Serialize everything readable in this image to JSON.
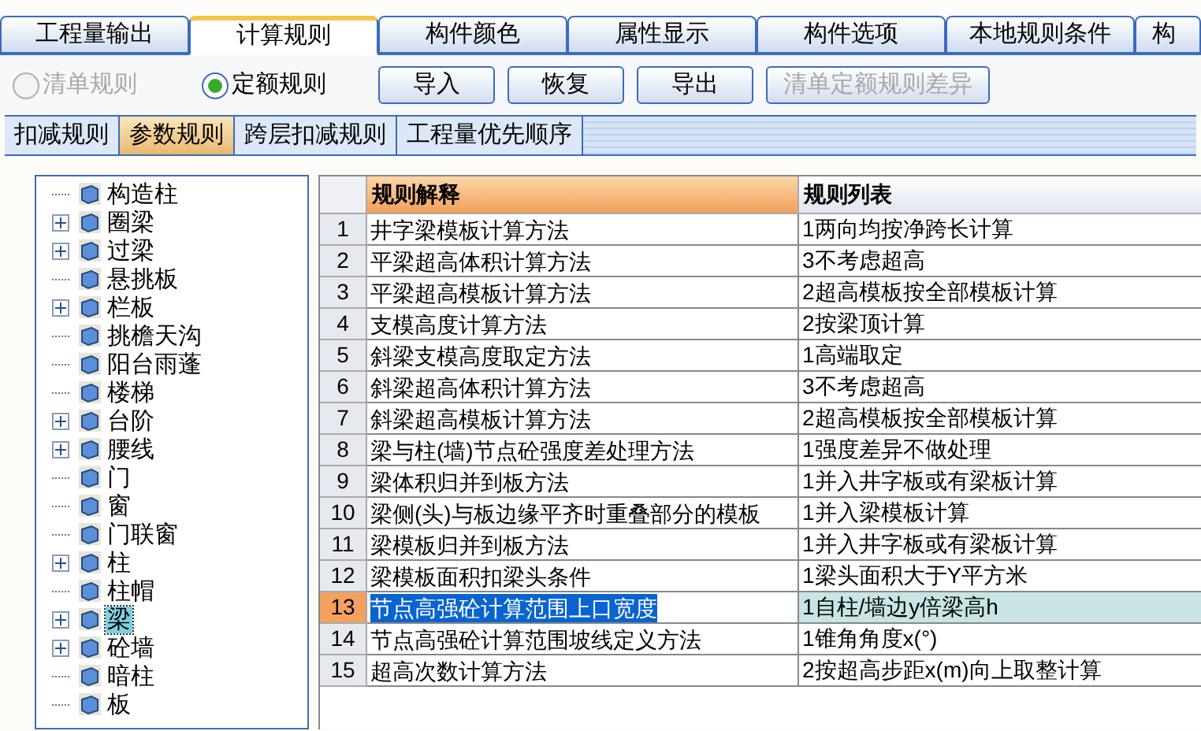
{
  "tabs": [
    {
      "label": "工程量输出",
      "selected": false
    },
    {
      "label": "计算规则",
      "selected": true
    },
    {
      "label": "构件颜色",
      "selected": false
    },
    {
      "label": "属性显示",
      "selected": false
    },
    {
      "label": "构件选项",
      "selected": false
    },
    {
      "label": "本地规则条件",
      "selected": false
    },
    {
      "label": "构",
      "selected": false
    }
  ],
  "radios": [
    {
      "label": "清单规则",
      "selected": false,
      "disabled": true
    },
    {
      "label": "定额规则",
      "selected": true,
      "disabled": false
    }
  ],
  "buttons": [
    {
      "label": "导入",
      "disabled": false
    },
    {
      "label": "恢复",
      "disabled": false
    },
    {
      "label": "导出",
      "disabled": false
    },
    {
      "label": "清单定额规则差异",
      "disabled": true
    }
  ],
  "sub_tabs": [
    {
      "label": "扣减规则",
      "selected": false
    },
    {
      "label": "参数规则",
      "selected": true
    },
    {
      "label": "跨层扣减规则",
      "selected": false
    },
    {
      "label": "工程量优先顺序",
      "selected": false
    }
  ],
  "tree": {
    "items": [
      {
        "label": "构造柱",
        "expandable": false,
        "selected": false
      },
      {
        "label": "圈梁",
        "expandable": true,
        "selected": false
      },
      {
        "label": "过梁",
        "expandable": true,
        "selected": false
      },
      {
        "label": "悬挑板",
        "expandable": false,
        "selected": false
      },
      {
        "label": "栏板",
        "expandable": true,
        "selected": false
      },
      {
        "label": "挑檐天沟",
        "expandable": false,
        "selected": false
      },
      {
        "label": "阳台雨蓬",
        "expandable": false,
        "selected": false
      },
      {
        "label": "楼梯",
        "expandable": false,
        "selected": false
      },
      {
        "label": "台阶",
        "expandable": true,
        "selected": false
      },
      {
        "label": "腰线",
        "expandable": true,
        "selected": false
      },
      {
        "label": "门",
        "expandable": false,
        "selected": false
      },
      {
        "label": "窗",
        "expandable": false,
        "selected": false
      },
      {
        "label": "门联窗",
        "expandable": false,
        "selected": false
      },
      {
        "label": "柱",
        "expandable": true,
        "selected": false
      },
      {
        "label": "柱帽",
        "expandable": false,
        "selected": false
      },
      {
        "label": "梁",
        "expandable": true,
        "selected": true
      },
      {
        "label": "砼墙",
        "expandable": true,
        "selected": false
      },
      {
        "label": "暗柱",
        "expandable": false,
        "selected": false
      },
      {
        "label": "板",
        "expandable": false,
        "selected": false
      }
    ]
  },
  "table": {
    "columns": [
      "规则解释",
      "规则列表"
    ],
    "rows": [
      {
        "number": "1",
        "rule": "井字梁模板计算方法",
        "value": "1两向均按净跨长计算",
        "selected": false
      },
      {
        "number": "2",
        "rule": "平梁超高体积计算方法",
        "value": "3不考虑超高",
        "selected": false
      },
      {
        "number": "3",
        "rule": "平梁超高模板计算方法",
        "value": "2超高模板按全部模板计算",
        "selected": false
      },
      {
        "number": "4",
        "rule": "支模高度计算方法",
        "value": "2按梁顶计算",
        "selected": false
      },
      {
        "number": "5",
        "rule": "斜梁支模高度取定方法",
        "value": "1高端取定",
        "selected": false
      },
      {
        "number": "6",
        "rule": "斜梁超高体积计算方法",
        "value": "3不考虑超高",
        "selected": false
      },
      {
        "number": "7",
        "rule": "斜梁超高模板计算方法",
        "value": "2超高模板按全部模板计算",
        "selected": false
      },
      {
        "number": "8",
        "rule": "梁与柱(墙)节点砼强度差处理方法",
        "value": "1强度差异不做处理",
        "selected": false
      },
      {
        "number": "9",
        "rule": "梁体积归并到板方法",
        "value": "1并入井字板或有梁板计算",
        "selected": false
      },
      {
        "number": "10",
        "rule": "梁侧(头)与板边缘平齐时重叠部分的模板",
        "value": "1并入梁模板计算",
        "selected": false
      },
      {
        "number": "11",
        "rule": "梁模板归并到板方法",
        "value": "1并入井字板或有梁板计算",
        "selected": false
      },
      {
        "number": "12",
        "rule": "梁模板面积扣梁头条件",
        "value": "1梁头面积大于Y平方米",
        "selected": false
      },
      {
        "number": "13",
        "rule": "节点高强砼计算范围上口宽度",
        "value": "1自柱/墙边y倍梁高h",
        "selected": true
      },
      {
        "number": "14",
        "rule": "节点高强砼计算范围坡线定义方法",
        "value": "1锥角角度x(°)",
        "selected": false
      },
      {
        "number": "15",
        "rule": "超高次数计算方法",
        "value": "2按超高步距x(m)向上取整计算",
        "selected": false
      }
    ]
  }
}
